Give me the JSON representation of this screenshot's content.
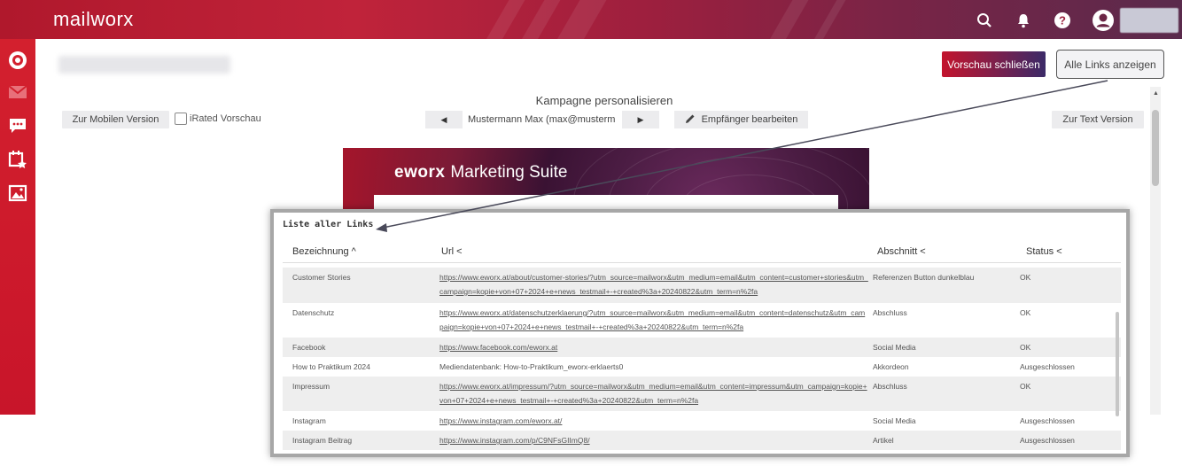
{
  "app": {
    "brand": "mailworx"
  },
  "header": {
    "icons": [
      "search-icon",
      "bell-icon",
      "help-icon",
      "user-icon"
    ]
  },
  "sidebar": {
    "icons": [
      "logo-icon",
      "mail-icon",
      "chat-icon",
      "calendar-star-icon",
      "image-icon"
    ]
  },
  "toolbar": {
    "preview_close": "Vorschau schließen",
    "show_all_links": "Alle Links anzeigen",
    "campaign_title": "Kampagne personalisieren",
    "mobile_version": "Zur Mobilen Version",
    "irated_label": "iRated Vorschau",
    "recipient_value": "Mustermann Max (max@musterm",
    "edit_recipient": "Empfänger bearbeiten",
    "text_version": "Zur Text Version"
  },
  "preview": {
    "logo_word": "eworx",
    "logo_rest": "Marketing Suite"
  },
  "links_panel": {
    "title": "Liste aller Links",
    "columns": {
      "name": "Bezeichnung ^",
      "url": "Url <",
      "section": "Abschnitt <",
      "status": "Status <"
    },
    "rows": [
      {
        "name": "Customer Stories",
        "url": "https://www.eworx.at/about/customer-stories/?utm_source=mailworx&utm_medium=email&utm_content=customer+stories&utm_campaign=kopie+von+07+2024+e+news_testmail+-+created%3a+20240822&utm_term=n%2fa",
        "section": "Referenzen Button dunkelblau",
        "status": "OK"
      },
      {
        "name": "Datenschutz",
        "url": "https://www.eworx.at/datenschutzerklaerung/?utm_source=mailworx&utm_medium=email&utm_content=datenschutz&utm_campaign=kopie+von+07+2024+e+news_testmail+-+created%3a+20240822&utm_term=n%2fa",
        "section": "Abschluss",
        "status": "OK"
      },
      {
        "name": "Facebook",
        "url": "https://www.facebook.com/eworx.at",
        "section": "Social Media",
        "status": "OK"
      },
      {
        "name": "How to Praktikum 2024",
        "url": "Mediendatenbank: How-to-Praktikum_eworx-erklaerts0",
        "section": "Akkordeon",
        "status": "Ausgeschlossen"
      },
      {
        "name": "Impressum",
        "url": "https://www.eworx.at/impressum/?utm_source=mailworx&utm_medium=email&utm_content=impressum&utm_campaign=kopie+von+07+2024+e+news_testmail+-+created%3a+20240822&utm_term=n%2fa",
        "section": "Abschluss",
        "status": "OK"
      },
      {
        "name": "Instagram",
        "url": "https://www.instagram.com/eworx.at/",
        "section": "Social Media",
        "status": "Ausgeschlossen"
      },
      {
        "name": "Instagram Beitrag",
        "url": "https://www.instagram.com/p/C9NFsGIImQ8/",
        "section": "Artikel",
        "status": "Ausgeschlossen"
      }
    ]
  },
  "colors": {
    "brand_red": "#c8152a",
    "accent_purple": "#3b2a68"
  }
}
